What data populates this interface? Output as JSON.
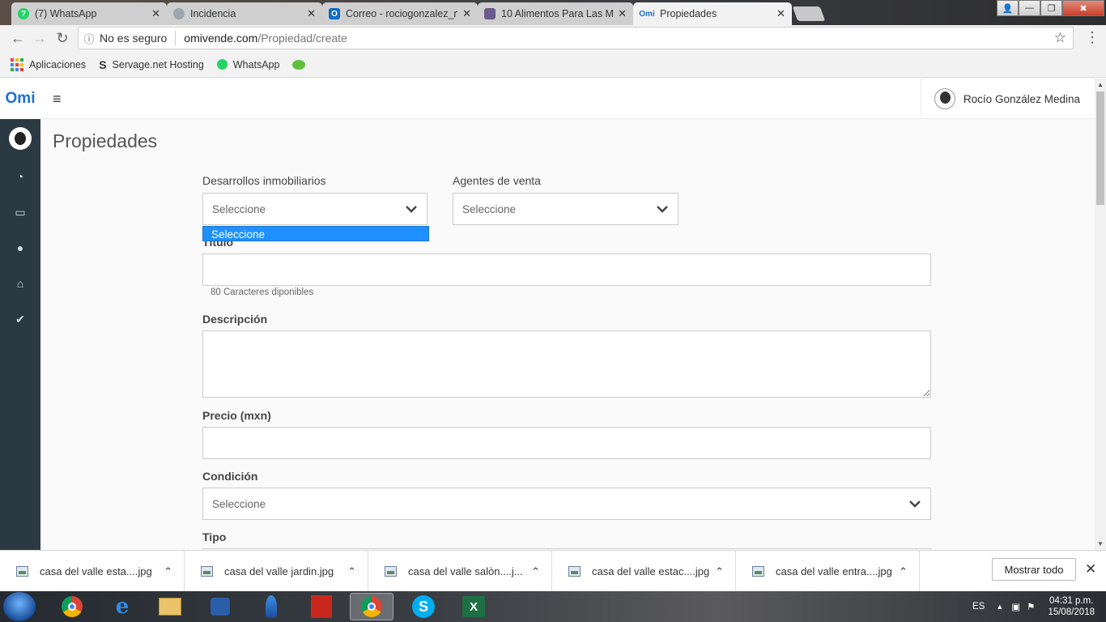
{
  "browser": {
    "tabs": [
      {
        "title": "(7) WhatsApp",
        "icon": "whatsapp-icon",
        "color": "#25d366"
      },
      {
        "title": "Incidencia",
        "icon": "page-icon",
        "color": "#9aa7b0"
      },
      {
        "title": "Correo - rociogonzalez_m",
        "icon": "outlook-icon",
        "color": "#0f6cc4"
      },
      {
        "title": "10 Alimentos Para Las M",
        "icon": "article-icon",
        "color": "#6b5a8c"
      },
      {
        "title": "Propiedades",
        "icon": "omi-icon",
        "color": "#1d6fd6"
      }
    ],
    "close_glyph": "✕",
    "omnibox": {
      "security": "No es seguro",
      "host": "omivende.com",
      "path": "/Propiedad/create"
    },
    "bookmarks": [
      {
        "label": "Aplicaciones",
        "icon": "apps-grid-icon"
      },
      {
        "label": "Servage.net Hosting",
        "icon": "servage-icon"
      },
      {
        "label": "WhatsApp",
        "icon": "whatsapp-icon"
      },
      {
        "label": "",
        "icon": "wechat-icon"
      }
    ]
  },
  "app": {
    "logo": "Omi",
    "user_name": "Rocío González Medina",
    "page_title": "Propiedades",
    "sidebar_icons": [
      "avatar-icon",
      "dashboard-icon",
      "monitor-icon",
      "user-icon",
      "home-icon",
      "check-circle-icon"
    ]
  },
  "form": {
    "desarrollos_label": "Desarrollos inmobiliarios",
    "desarrollos_value": "Seleccione",
    "desarrollos_dropdown_option": "Seleccione",
    "agentes_label": "Agentes de venta",
    "agentes_value": "Seleccione",
    "titulo_label": "Título",
    "titulo_hint": "80 Caracteres diponibles",
    "descripcion_label": "Descripción",
    "precio_label": "Precio (mxn)",
    "condicion_label": "Condición",
    "condicion_value": "Seleccione",
    "tipo_label": "Tipo"
  },
  "downloads": {
    "items": [
      "casa del valle esta....jpg",
      "casa del valle jardin.jpg",
      "casa del valle salòn....j...",
      "casa del valle estac....jpg",
      "casa del valle entra....jpg"
    ],
    "show_all": "Mostrar todo"
  },
  "taskbar": {
    "lang": "ES",
    "time": "04:31 p.m.",
    "date": "15/08/2018",
    "apps": [
      "chrome-icon",
      "ie-icon",
      "explorer-icon",
      "media-icon",
      "sharpdevelop-icon",
      "acrobat-icon",
      "chrome-icon",
      "skype-icon",
      "excel-icon"
    ]
  }
}
